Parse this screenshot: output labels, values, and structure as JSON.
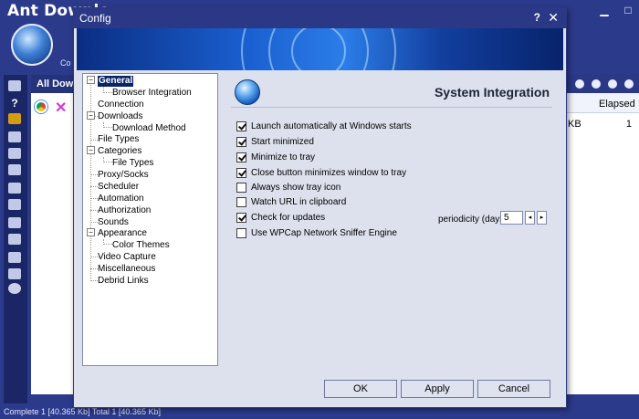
{
  "main": {
    "title": "Ant Downlo",
    "logo_label": "Co",
    "list_tab": "All Down",
    "row_size": "KB",
    "elapsed_header": "Elapsed",
    "row_elapsed": "1",
    "status": "Complete 1 [40.365 Kb]  Total 1 [40.365 Kb]",
    "help_symbol": "?"
  },
  "dialog": {
    "title": "Config",
    "help": "?",
    "close": "✕",
    "section_title": "System Integration",
    "tree": [
      {
        "label": "General",
        "expander": "−"
      },
      {
        "label": "Browser Integration"
      },
      {
        "label": "Connection"
      },
      {
        "label": "Downloads",
        "expander": "−"
      },
      {
        "label": "Download Method"
      },
      {
        "label": "File Types"
      },
      {
        "label": "Categories",
        "expander": "−"
      },
      {
        "label": "File Types"
      },
      {
        "label": "Proxy/Socks"
      },
      {
        "label": "Scheduler"
      },
      {
        "label": "Automation"
      },
      {
        "label": "Authorization"
      },
      {
        "label": "Sounds"
      },
      {
        "label": "Appearance",
        "expander": "−"
      },
      {
        "label": "Color Themes"
      },
      {
        "label": "Video Capture"
      },
      {
        "label": "Miscellaneous"
      },
      {
        "label": "Debrid Links"
      }
    ],
    "options": [
      {
        "label": "Launch automatically at Windows starts",
        "checked": true
      },
      {
        "label": "Start minimized",
        "checked": true
      },
      {
        "label": "Minimize to tray",
        "checked": true
      },
      {
        "label": "Close button minimizes window to tray",
        "checked": true
      },
      {
        "label": "Always show tray icon",
        "checked": false
      },
      {
        "label": "Watch URL in clipboard",
        "checked": false
      },
      {
        "label": "Check for updates",
        "checked": true
      },
      {
        "label": "Use WPCap Network Sniffer Engine",
        "checked": false
      }
    ],
    "periodicity_label": "periodicity (days)",
    "periodicity_value": "5",
    "spin_left": "◂",
    "spin_right": "▸",
    "buttons": {
      "ok": "OK",
      "apply": "Apply",
      "cancel": "Cancel"
    }
  }
}
